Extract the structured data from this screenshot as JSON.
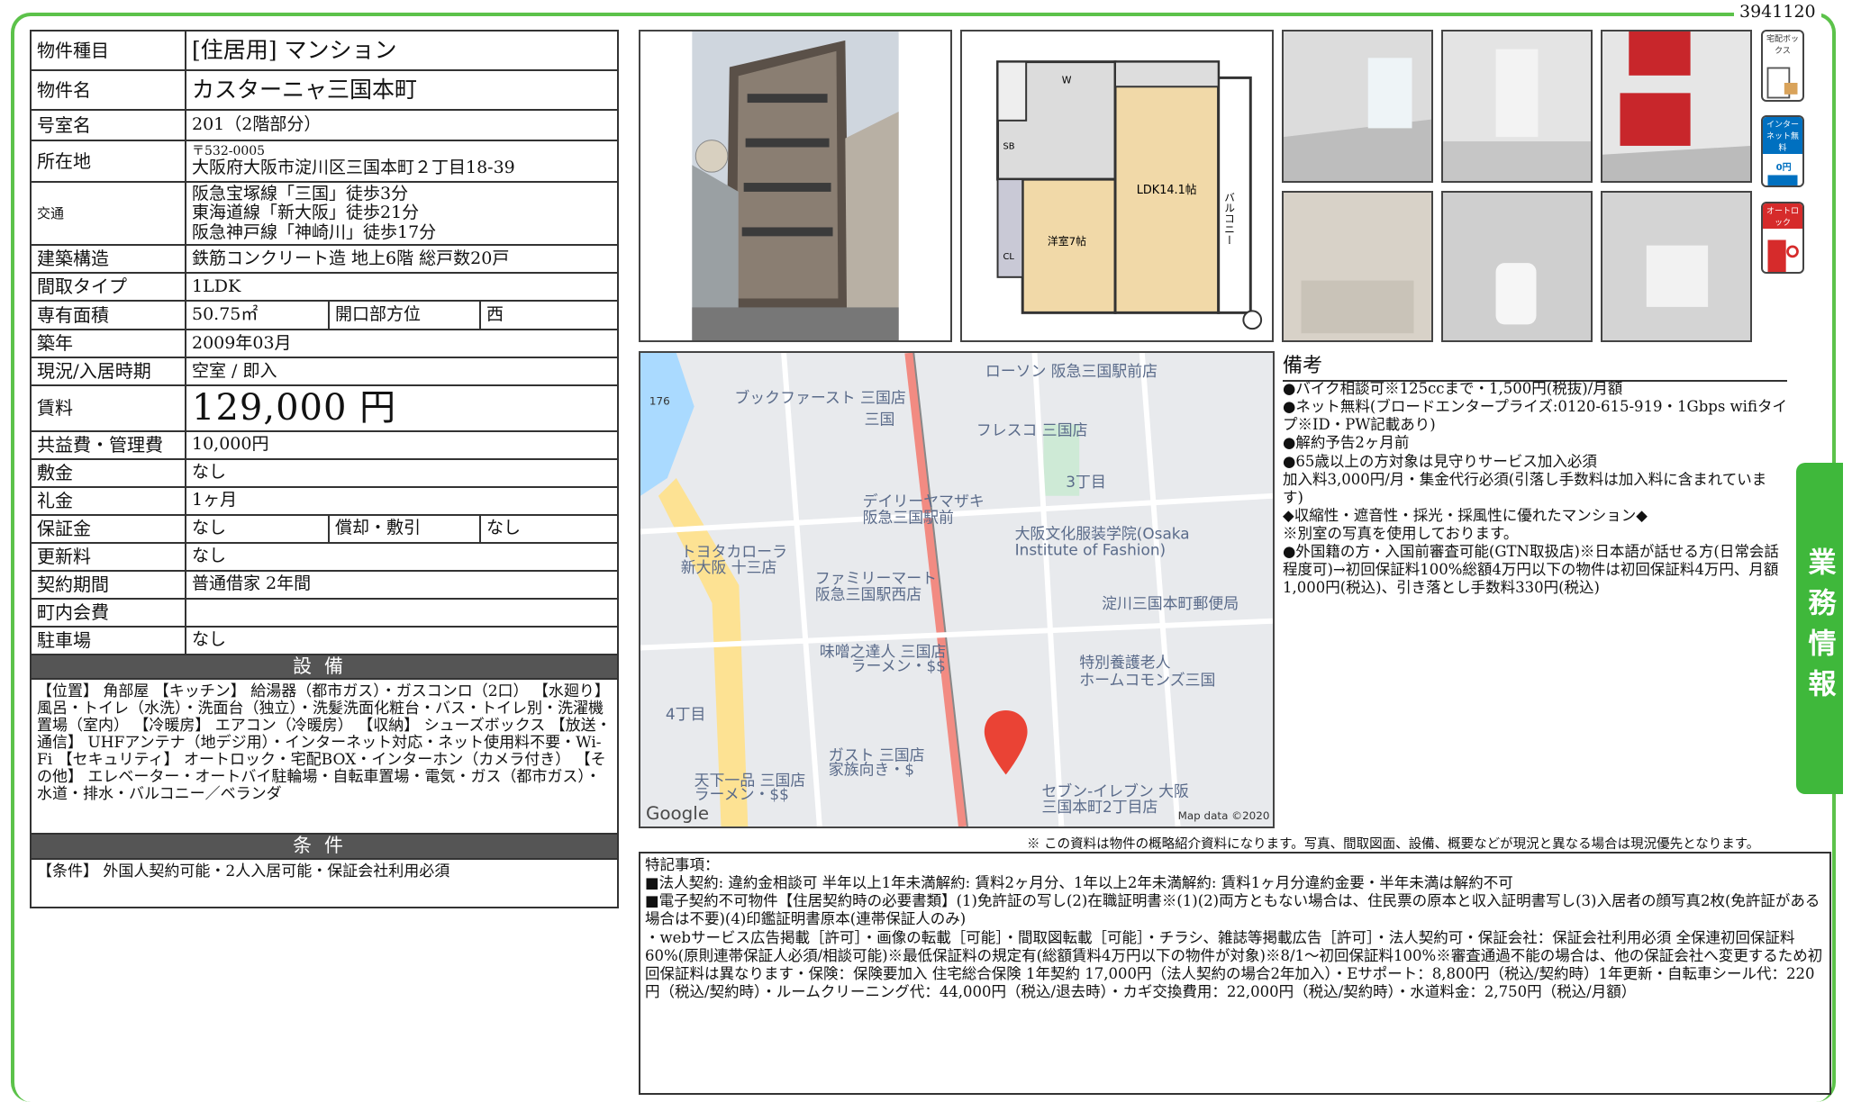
{
  "doc_id": "3941120",
  "property": {
    "type_label": "物件種目",
    "type_value": "[住居用] マンション",
    "name_label": "物件名",
    "name_value": "カスターニャ三国本町",
    "room_label": "号室名",
    "room_value": "201（2階部分）",
    "address_label": "所在地",
    "postal": "〒532-0005",
    "address": "大阪府大阪市淀川区三国本町２丁目18-39",
    "transit_label": "交通",
    "transit": [
      "阪急宝塚線「三国」徒歩3分",
      "東海道線「新大阪」徒歩21分",
      "阪急神戸線「神崎川」徒歩17分"
    ],
    "structure_label": "建築構造",
    "structure_value": "鉄筋コンクリート造 地上6階 総戸数20戸",
    "layout_label": "間取タイプ",
    "layout_value": "1LDK",
    "area_label": "専有面積",
    "area_value": "50.75㎡",
    "direction_label": "開口部方位",
    "direction_value": "西",
    "built_label": "築年",
    "built_value": "2009年03月",
    "status_label": "現況/入居時期",
    "status_value": "空室 / 即入",
    "rent_label": "賃料",
    "rent_value": "129,000 円",
    "fee_label": "共益費・管理費",
    "fee_value": "10,000円",
    "deposit_label": "敷金",
    "deposit_value": "なし",
    "keymoney_label": "礼金",
    "keymoney_value": "1ヶ月",
    "guarantee_label": "保証金",
    "guarantee_value": "なし",
    "amort_label": "償却・敷引",
    "amort_value": "なし",
    "renew_label": "更新料",
    "renew_value": "なし",
    "contract_label": "契約期間",
    "contract_value": "普通借家 2年間",
    "assoc_label": "町内会費",
    "assoc_value": "",
    "parking_label": "駐車場",
    "parking_value": "なし"
  },
  "equipment": {
    "title": "設備",
    "text": "【位置】 角部屋 【キッチン】 給湯器（都市ガス）・ガスコンロ（2口） 【水廻り】 風呂・トイレ（水洗）・洗面台（独立）・洗髪洗面化粧台・バス・トイレ別・洗濯機置場（室内） 【冷暖房】 エアコン（冷暖房） 【収納】 シューズボックス 【放送・通信】 UHFアンテナ（地デジ用）・インターネット対応・ネット使用料不要・Wi-Fi 【セキュリティ】 オートロック・宅配BOX・インターホン（カメラ付き） 【その他】 エレベーター・オートバイ駐輪場・自転車置場・電気・ガス（都市ガス）・水道・排水・バルコニー／ベランダ"
  },
  "conditions": {
    "title": "条件",
    "text": "【条件】 外国人契約可能・2人入居可能・保証会社利用必須"
  },
  "badges": {
    "delivery": "宅配ボックス",
    "internet": "インターネット無料",
    "internet_price": "0円",
    "autolock": "オートロック"
  },
  "floorplan": {
    "w": "W",
    "sb": "SB",
    "cl": "CL",
    "ldk": "LDK14.1帖",
    "room": "洋室7帖",
    "balcony": "バルコニー"
  },
  "map": {
    "labels": [
      "ローソン 阪急三国駅前店",
      "ブックファースト 三国店",
      "三国",
      "フレスコ 三国店",
      "3丁目",
      "デイリーヤマザキ",
      "阪急三国駅前",
      "大阪文化服装学院(Osaka",
      "Institute of Fashion)",
      "トヨタカローラ",
      "新大阪 十三店",
      "ファミリーマート",
      "阪急三国駅西店",
      "淀川三国本町郵便局",
      "味噌之達人 三国店",
      "ラーメン・$$",
      "特別養護老人",
      "ホームコモンズ三国",
      "4丁目",
      "ガスト 三国店",
      "家族向き・$",
      "天下一品 三国店",
      "ラーメン・$$",
      "セブン-イレブン 大阪",
      "三国本町2丁目店",
      "Google",
      "Map data ©2020",
      "176"
    ]
  },
  "remarks": {
    "title": "備考",
    "lines": [
      "●バイク相談可※125ccまで・1,500円(税抜)/月額",
      "●ネット無料(ブロードエンタープライズ:0120-615-919・1Gbps wifiタイプ※ID・PW記載あり)",
      "●解約予告2ヶ月前",
      "●65歳以上の方対象は見守りサービス加入必須",
      "加入料3,000円/月・集金代行必須(引落し手数料は加入料に含まれています)",
      "◆収縮性・遮音性・採光・採風性に優れたマンション◆",
      "※別室の写真を使用しております。",
      "●外国籍の方・入国前審査可能(GTN取扱店)※日本語が話せる方(日常会話程度可)→初回保証料100%総額4万円以下の物件は初回保証料4万円、月額1,000円(税込)、引き落とし手数料330円(税込)"
    ]
  },
  "note": "※ この資料は物件の概略紹介資料になります。写真、間取図面、設備、概要などが現況と異なる場合は現況優先となります。",
  "special": {
    "title": "特記事項：",
    "lines": [
      "■法人契約: 違約金相談可 半年以上1年未満解約: 賃料2ヶ月分、1年以上2年未満解約: 賃料1ヶ月分違約金要・半年未満は解約不可",
      "■電子契約不可物件【住居契約時の必要書類】(1)免許証の写し(2)在職証明書※(1)(2)両方ともない場合は、住民票の原本と収入証明書写し(3)入居者の顔写真2枚(免許証がある場合は不要)(4)印鑑証明書原本(連帯保証人のみ)",
      "・webサービス広告掲載［許可］・画像の転載［可能］・間取図転載［可能］・チラシ、雑誌等掲載広告［許可］・法人契約可・保証会社：保証会社利用必須 全保連初回保証料60%(原則連帯保証人必須/相談可能)※最低保証料の規定有(総額賃料4万円以下の物件が対象)※8/1～初回保証料100%※審査通過不能の場合は、他の保証会社へ変更するため初回保証料は異なります・保険：保険要加入 住宅総合保険 1年契約 17,000円（法人契約の場合2年加入）・Eサポート：8,800円（税込/契約時）1年更新・自転車シール代：220円（税込/契約時）・ルームクリーニング代：44,000円（税込/退去時）・カギ交換費用：22,000円（税込/契約時）・水道料金：2,750円（税込/月額）"
    ]
  },
  "side_tab": "業務情報"
}
